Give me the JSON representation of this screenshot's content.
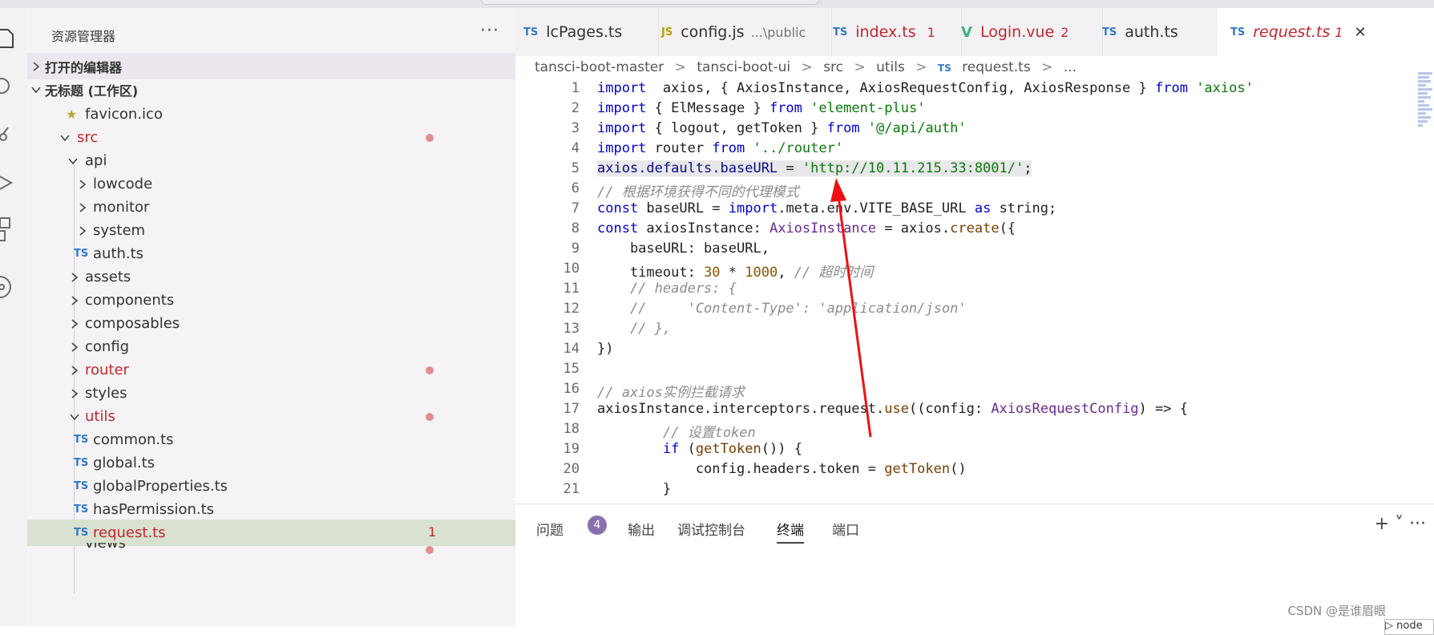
{
  "window": {},
  "sidebar": {
    "title": "资源管理器",
    "more": "···",
    "open_editors": "打开的编辑器",
    "workspace": "无标题 (工作区)",
    "tree": [
      {
        "label": "favicon.ico"
      },
      {
        "label": "src"
      },
      {
        "label": "api"
      },
      {
        "label": "lowcode"
      },
      {
        "label": "monitor"
      },
      {
        "label": "system"
      },
      {
        "label": "auth.ts",
        "icon": "TS"
      },
      {
        "label": "assets"
      },
      {
        "label": "components"
      },
      {
        "label": "composables"
      },
      {
        "label": "config"
      },
      {
        "label": "router"
      },
      {
        "label": "styles"
      },
      {
        "label": "utils"
      },
      {
        "label": "common.ts",
        "icon": "TS"
      },
      {
        "label": "global.ts",
        "icon": "TS"
      },
      {
        "label": "globalProperties.ts",
        "icon": "TS"
      },
      {
        "label": "hasPermission.ts",
        "icon": "TS"
      },
      {
        "label": "request.ts",
        "icon": "TS",
        "count": "1"
      },
      {
        "label": "views"
      }
    ]
  },
  "tabs": [
    {
      "icon": "TS",
      "label": "lcPages.ts",
      "extra": ""
    },
    {
      "icon": "JS",
      "label": "config.js",
      "extra": "...\\public"
    },
    {
      "icon": "TS",
      "label": "index.ts",
      "extra": "1"
    },
    {
      "icon": "V",
      "label": "Login.vue",
      "extra": "2"
    },
    {
      "icon": "TS",
      "label": "auth.ts",
      "extra": ""
    },
    {
      "icon": "TS",
      "label": "request.ts",
      "extra": "1",
      "close": "✕"
    }
  ],
  "breadcrumb": [
    "tansci-boot-master",
    ">",
    "tansci-boot-ui",
    ">",
    "src",
    ">",
    "utils",
    ">",
    "TS",
    "request.ts",
    ">",
    "..."
  ],
  "code": {
    "line_numbers": [
      "1",
      "2",
      "3",
      "4",
      "5",
      "6",
      "7",
      "8",
      "9",
      "10",
      "11",
      "12",
      "13",
      "14",
      "15",
      "16",
      "17",
      "18",
      "19",
      "20",
      "21"
    ]
  },
  "panel": {
    "problems": "问题",
    "problems_count": "4",
    "output": "输出",
    "debug_console": "调试控制台",
    "terminal": "终端",
    "ports": "端口",
    "actions": "+ ˅ ···",
    "credit": "CSDN @是谁眉眼",
    "term_label": "▷ node"
  }
}
